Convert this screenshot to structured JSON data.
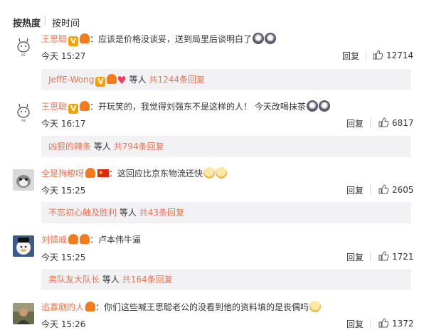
{
  "sort": {
    "hot": "按热度",
    "time": "按时间"
  },
  "comments": [
    {
      "user": "王思聪",
      "text": "：应该是价格没谈妥，送到局里后谈明白了",
      "time": "今天 15:27",
      "reply": "回复",
      "likes": "12714",
      "sub": {
        "who": "JeffE-Wong",
        "mid": "等人",
        "count": "共1244条回复"
      }
    },
    {
      "user": "王思聪",
      "text": "：开玩笑的，我觉得刘强东不是这样的人！ 今天改喝抹茶",
      "time": "今天 16:17",
      "reply": "回复",
      "likes": "6817",
      "sub": {
        "who": "凶狠的辣条",
        "mid": "等人",
        "count": "共794条回复"
      }
    },
    {
      "user": "全是狗粮呀",
      "text": "：这回应比京东物流还快",
      "time": "今天 15:25",
      "reply": "回复",
      "likes": "2605",
      "sub": {
        "who": "不忘初心触及胜利",
        "mid": "等人",
        "count": "共43条回复"
      }
    },
    {
      "user": "刘慥威",
      "text": "：卢本伟牛逼",
      "time": "今天 15:25",
      "reply": "回复",
      "likes": "1721",
      "sub": {
        "who": "卖队友大队长",
        "mid": "等人",
        "count": "共164条回复"
      }
    },
    {
      "user": "追寡剧的人",
      "text": "：你们这些喊王思聪老公的没看到他的资料填的是丧偶吗",
      "time": "今天 15:26",
      "reply": "回复",
      "likes": "1372"
    }
  ],
  "colors": {
    "username": "#eb7350",
    "subbox_bg": "#f2f2f5",
    "vip_badge": "#f7a100"
  }
}
